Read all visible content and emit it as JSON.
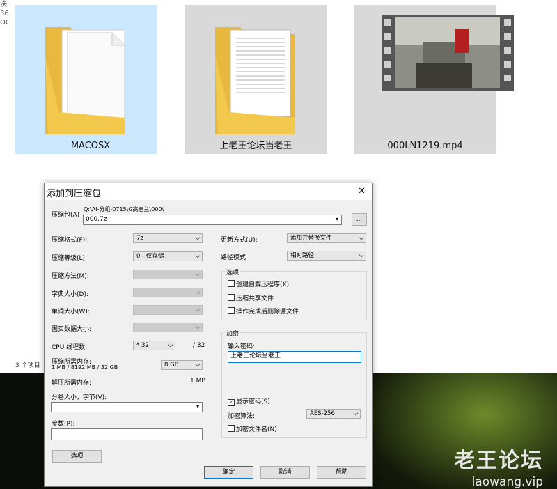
{
  "explorer": {
    "left_fragments": [
      "決",
      "36",
      "OC"
    ],
    "items": [
      {
        "name": "__MACOSX",
        "icon": "folder-icon",
        "selected": true
      },
      {
        "name": "上老王论坛当老王",
        "icon": "folder-icon",
        "selected": false
      },
      {
        "name": "000LN1219.mp4",
        "icon": "video-thumbnail",
        "selected": false
      }
    ],
    "status": "3 个项目"
  },
  "watermark": {
    "cn": "老王论坛",
    "url": "laowang.vip"
  },
  "dialog": {
    "title": "添加到压缩包",
    "close": "✕",
    "archive_label": "压缩包(A)",
    "archive_path": "Q:\\AI-分组-0715\\G高启兰\\000\\",
    "archive_name": "000.7z",
    "browse": "...",
    "format_label": "压缩格式(F):",
    "format_value": "7z",
    "level_label": "压缩等级(L):",
    "level_value": "0 - 仅存储",
    "method_label": "压缩方法(M):",
    "dict_label": "字典大小(D):",
    "word_label": "单词大小(W):",
    "solid_label": "固实数据大小:",
    "threads_label": "CPU 线程数:",
    "threads_value": "* 32",
    "threads_max": "/ 32",
    "mem_comp_label": "压缩所需内存:",
    "mem_comp_detail": "1 MB / 8192 MB / 32 GB",
    "mem_comp_value": "8 GB",
    "mem_decomp_label": "解压所需内存:",
    "mem_decomp_value": "1 MB",
    "split_label": "分卷大小，字节(V):",
    "params_label": "参数(P):",
    "options_btn": "选项",
    "update_label": "更新方式(U):",
    "update_value": "添加并替换文件",
    "path_label": "路径模式",
    "path_value": "相对路径",
    "options_group": "选项",
    "opt_sfx": "创建自解压程序(X)",
    "opt_shared": "压缩共享文件",
    "opt_delete": "操作完成后删除源文件",
    "enc_group": "加密",
    "pwd_label": "输入密码:",
    "pwd_value": "上老王论坛当老王",
    "show_pwd": "显示密码(S)",
    "enc_method_label": "加密算法:",
    "enc_method_value": "AES-256",
    "enc_names": "加密文件名(N)",
    "ok": "确定",
    "cancel": "取消",
    "help": "帮助"
  }
}
